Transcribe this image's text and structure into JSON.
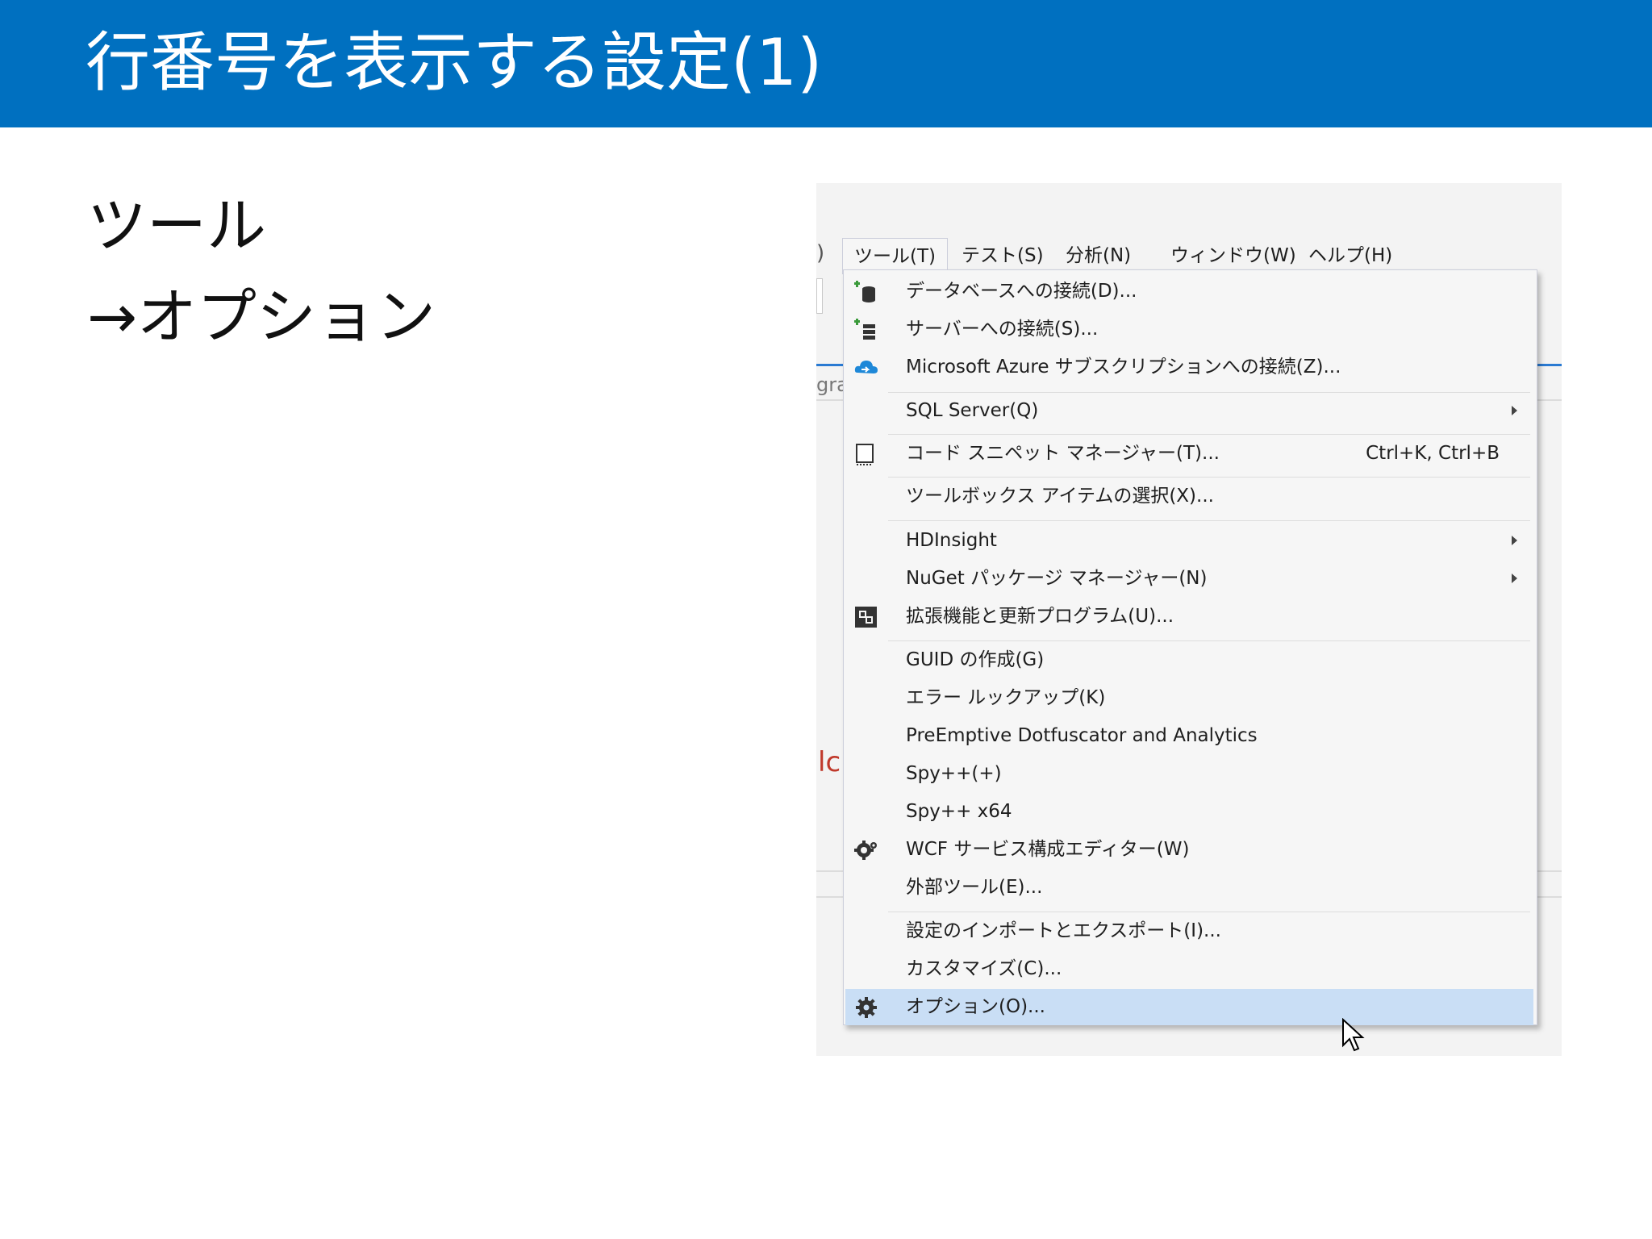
{
  "slide": {
    "title": "行番号を表示する設定(1)",
    "line1": "ツール",
    "line2": "→オプション"
  },
  "screenshot": {
    "fragments": {
      "paren": ")",
      "gra": "gra",
      "lc": "lc"
    },
    "menubar": [
      {
        "label": "ツール(T)",
        "active": true
      },
      {
        "label": "テスト(S)"
      },
      {
        "label": "分析(N)"
      },
      {
        "label": "ウィンドウ(W)"
      },
      {
        "label": "ヘルプ(H)"
      }
    ],
    "menu": {
      "items": {
        "db_connect": {
          "label": "データベースへの接続(D)...",
          "icon": "database-connect-icon"
        },
        "server_connect": {
          "label": "サーバーへの接続(S)...",
          "icon": "server-connect-icon"
        },
        "azure": {
          "label": "Microsoft Azure サブスクリプションへの接続(Z)...",
          "icon": "azure-cloud-icon"
        },
        "sql_server": {
          "label": "SQL Server(Q)",
          "submenu": true
        },
        "snippet": {
          "label": "コード スニペット マネージャー(T)...",
          "shortcut": "Ctrl+K, Ctrl+B",
          "icon": "snippet-icon"
        },
        "toolbox": {
          "label": "ツールボックス アイテムの選択(X)..."
        },
        "hdinsight": {
          "label": "HDInsight",
          "submenu": true
        },
        "nuget": {
          "label": "NuGet パッケージ マネージャー(N)",
          "submenu": true
        },
        "extensions": {
          "label": "拡張機能と更新プログラム(U)...",
          "icon": "extensions-icon"
        },
        "guid": {
          "label": "GUID の作成(G)"
        },
        "error_lookup": {
          "label": "エラー ルックアップ(K)"
        },
        "preemptive": {
          "label": "PreEmptive Dotfuscator and Analytics"
        },
        "spy": {
          "label": "Spy++(+)"
        },
        "spy64": {
          "label": "Spy++ x64"
        },
        "wcf": {
          "label": "WCF サービス構成エディター(W)",
          "icon": "wcf-gear-icon"
        },
        "external": {
          "label": "外部ツール(E)..."
        },
        "import_export": {
          "label": "設定のインポートとエクスポート(I)..."
        },
        "customize": {
          "label": "カスタマイズ(C)..."
        },
        "options": {
          "label": "オプション(O)...",
          "icon": "gear-icon",
          "highlighted": true
        }
      }
    },
    "colors": {
      "title_bar": "#0070c0",
      "menu_bg": "#f6f6f6",
      "highlight": "#c9def5",
      "accent_blue": "#2a7ad2"
    }
  }
}
